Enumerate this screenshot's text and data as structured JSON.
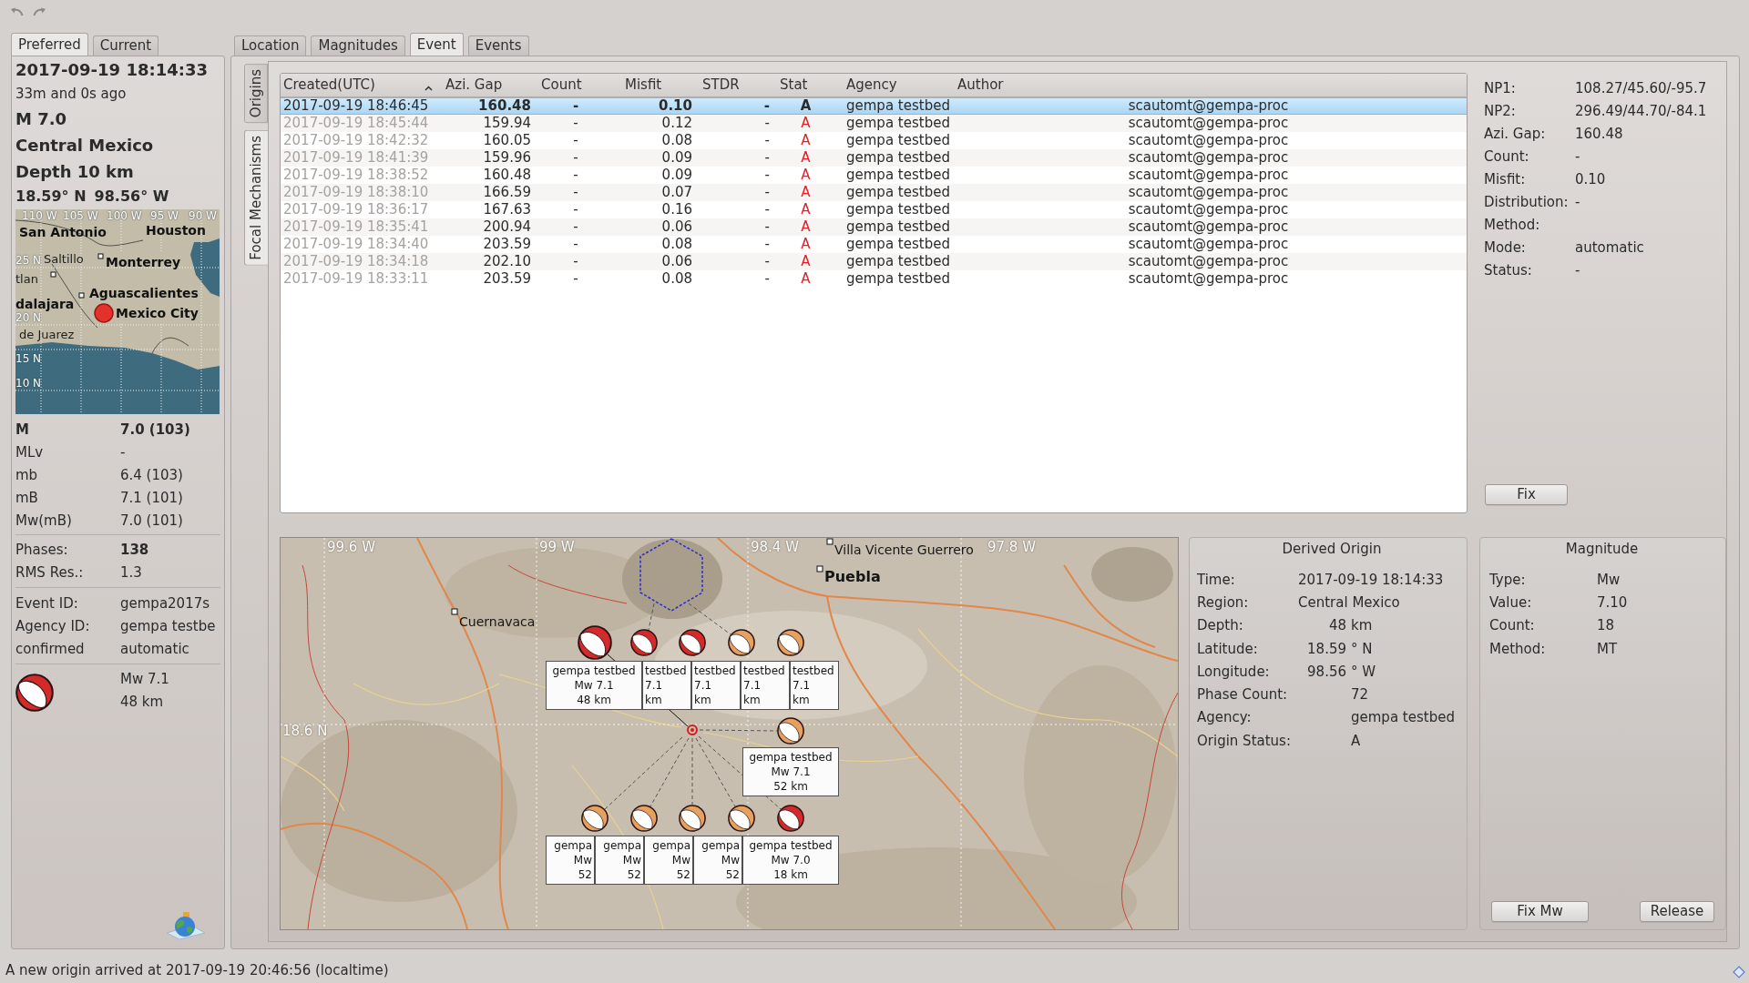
{
  "left_panel": {
    "tabs": [
      {
        "label": "Preferred",
        "selected": true
      },
      {
        "label": "Current",
        "selected": false
      }
    ],
    "summary": {
      "time": "2017-09-19 18:14:33",
      "age": "33m and 0s ago",
      "magnitude": "M 7.0",
      "region": "Central Mexico",
      "depth": "Depth 10 km",
      "latitude": "18.59° N",
      "longitude": "98.56° W"
    },
    "mini_map": {
      "grid_labels": [
        "110 W",
        "105 W",
        "100 W",
        "95 W",
        "90 W",
        "25 N",
        "20 N",
        "15 N",
        "10 N"
      ],
      "cities": [
        {
          "name": "San Antonio",
          "major": true
        },
        {
          "name": "Houston",
          "major": true
        },
        {
          "name": "Saltillo",
          "major": false
        },
        {
          "name": "tlan",
          "major": false
        },
        {
          "name": "Monterrey",
          "major": true
        },
        {
          "name": "Aguascalientes",
          "major": true
        },
        {
          "name": "dalajara",
          "major": true
        },
        {
          "name": "Mexico City",
          "major": true
        },
        {
          "name": "de Juarez",
          "major": false
        }
      ]
    },
    "magnitudes": [
      {
        "type": "M",
        "value": "7.0 (103)",
        "preferred": true
      },
      {
        "type": "MLv",
        "value": "-",
        "preferred": false
      },
      {
        "type": "mb",
        "value": "6.4 (103)",
        "preferred": false
      },
      {
        "type": "mB",
        "value": "7.1 (101)",
        "preferred": false
      },
      {
        "type": "Mw(mB)",
        "value": "7.0 (101)",
        "preferred": false
      }
    ],
    "quality": [
      {
        "label": "Phases:",
        "value": "138",
        "emphasized": true
      },
      {
        "label": "RMS Res.:",
        "value": "1.3",
        "emphasized": false
      }
    ],
    "identifiers": [
      {
        "label": "Event ID:",
        "value": "gempa2017s"
      },
      {
        "label": "Agency ID:",
        "value": "gempa testbe"
      },
      {
        "label": "confirmed",
        "value": "automatic"
      }
    ],
    "mechanism": {
      "magnitude": "Mw 7.1",
      "depth": "48 km"
    }
  },
  "main_tabs": [
    {
      "label": "Location",
      "selected": false
    },
    {
      "label": "Magnitudes",
      "selected": false
    },
    {
      "label": "Event",
      "selected": true
    },
    {
      "label": "Events",
      "selected": false
    }
  ],
  "side_tabs": [
    {
      "label": "Origins",
      "selected": false
    },
    {
      "label": "Focal Mechanisms",
      "selected": true
    }
  ],
  "table": {
    "columns": [
      {
        "label": "Created(UTC)",
        "sorted": true
      },
      {
        "label": "Azi. Gap",
        "sorted": false
      },
      {
        "label": "Count",
        "sorted": false
      },
      {
        "label": "Misfit",
        "sorted": false
      },
      {
        "label": "STDR",
        "sorted": false
      },
      {
        "label": "Stat",
        "sorted": false
      },
      {
        "label": "Agency",
        "sorted": false
      },
      {
        "label": "Author",
        "sorted": false
      }
    ],
    "rows": [
      {
        "cells": [
          "2017-09-19 18:46:45",
          "160.48",
          "-",
          "0.10",
          "-",
          "A",
          "gempa testbed",
          "scautomt@gempa-proc"
        ],
        "selected": true,
        "preferred": true
      },
      {
        "cells": [
          "2017-09-19 18:45:44",
          "159.94",
          "-",
          "0.12",
          "-",
          "A",
          "gempa testbed",
          "scautomt@gempa-proc"
        ],
        "selected": false,
        "preferred": false
      },
      {
        "cells": [
          "2017-09-19 18:42:32",
          "160.05",
          "-",
          "0.08",
          "-",
          "A",
          "gempa testbed",
          "scautomt@gempa-proc"
        ],
        "selected": false,
        "preferred": false
      },
      {
        "cells": [
          "2017-09-19 18:41:39",
          "159.96",
          "-",
          "0.09",
          "-",
          "A",
          "gempa testbed",
          "scautomt@gempa-proc"
        ],
        "selected": false,
        "preferred": false
      },
      {
        "cells": [
          "2017-09-19 18:38:52",
          "160.48",
          "-",
          "0.09",
          "-",
          "A",
          "gempa testbed",
          "scautomt@gempa-proc"
        ],
        "selected": false,
        "preferred": false
      },
      {
        "cells": [
          "2017-09-19 18:38:10",
          "166.59",
          "-",
          "0.07",
          "-",
          "A",
          "gempa testbed",
          "scautomt@gempa-proc"
        ],
        "selected": false,
        "preferred": false
      },
      {
        "cells": [
          "2017-09-19 18:36:17",
          "167.63",
          "-",
          "0.16",
          "-",
          "A",
          "gempa testbed",
          "scautomt@gempa-proc"
        ],
        "selected": false,
        "preferred": false
      },
      {
        "cells": [
          "2017-09-19 18:35:41",
          "200.94",
          "-",
          "0.06",
          "-",
          "A",
          "gempa testbed",
          "scautomt@gempa-proc"
        ],
        "selected": false,
        "preferred": false
      },
      {
        "cells": [
          "2017-09-19 18:34:40",
          "203.59",
          "-",
          "0.08",
          "-",
          "A",
          "gempa testbed",
          "scautomt@gempa-proc"
        ],
        "selected": false,
        "preferred": false
      },
      {
        "cells": [
          "2017-09-19 18:34:18",
          "202.10",
          "-",
          "0.06",
          "-",
          "A",
          "gempa testbed",
          "scautomt@gempa-proc"
        ],
        "selected": false,
        "preferred": false
      },
      {
        "cells": [
          "2017-09-19 18:33:11",
          "203.59",
          "-",
          "0.08",
          "-",
          "A",
          "gempa testbed",
          "scautomt@gempa-proc"
        ],
        "selected": false,
        "preferred": false
      }
    ]
  },
  "mechanism_details": {
    "rows": [
      {
        "label": "NP1:",
        "value": "108.27/45.60/-95.7"
      },
      {
        "label": "NP2:",
        "value": "296.49/44.70/-84.1"
      },
      {
        "label": "Azi. Gap:",
        "value": "160.48"
      },
      {
        "label": "Count:",
        "value": "-"
      },
      {
        "label": "Misfit:",
        "value": "0.10"
      },
      {
        "label": "Distribution:",
        "value": "-"
      },
      {
        "label": "Method:"
      },
      {
        "label": "Mode:",
        "value": "automatic"
      },
      {
        "label": "Status:",
        "value": "-"
      }
    ],
    "button": "Fix"
  },
  "map": {
    "grid_labels": [
      "99.6 W",
      "99 W",
      "98.4 W",
      "97.8 W",
      "18.6 N"
    ],
    "cities": [
      {
        "name": "Cuernavaca",
        "major": false
      },
      {
        "name": "Villa Vicente Guerrero",
        "major": false
      },
      {
        "name": "Puebla",
        "major": true
      }
    ],
    "mechanisms": [
      {
        "color": "#d42a2a",
        "label": [
          "gempa testbed",
          "Mw 7.1",
          "48 km"
        ]
      },
      {
        "color": "#d42a2a",
        "label": [
          "testbed",
          "7.1",
          "km"
        ]
      },
      {
        "color": "#d42a2a",
        "label": [
          "testbed",
          "7.1",
          "km"
        ]
      },
      {
        "color": "#e6a060",
        "label": [
          "testbed",
          "7.1",
          "km"
        ]
      },
      {
        "color": "#e6a060",
        "label": [
          "testbed",
          "7.1",
          "km"
        ]
      },
      {
        "color": "#e6a060",
        "label": [
          "gempa testbed",
          "Mw 7.1",
          "52 km"
        ]
      },
      {
        "color": "#e6a060",
        "label": [
          "gempa",
          "Mw",
          "52"
        ]
      },
      {
        "color": "#e6a060",
        "label": [
          "gempa",
          "Mw",
          "52"
        ]
      },
      {
        "color": "#e6a060",
        "label": [
          "gempa",
          "Mw",
          "52"
        ]
      },
      {
        "color": "#e6a060",
        "label": [
          "gempa",
          "Mw",
          "52"
        ]
      },
      {
        "color": "#d42a2a",
        "label": [
          "gempa testbed",
          "Mw 7.0",
          "18 km"
        ]
      }
    ]
  },
  "derived_origin": {
    "title": "Derived Origin",
    "rows": [
      {
        "kind": "wide",
        "label": "Time:",
        "value": "2017-09-19 18:14:33"
      },
      {
        "kind": "wide",
        "label": "Region:",
        "value": "Central Mexico"
      },
      {
        "kind": "measure",
        "label": "Depth:",
        "value": "48",
        "unit": "km"
      },
      {
        "kind": "measure",
        "label": "Latitude:",
        "value": "18.59",
        "unit": "° N"
      },
      {
        "kind": "measure",
        "label": "Longitude:",
        "value": "98.56",
        "unit": "° W"
      },
      {
        "kind": "plain",
        "label": "Phase Count:",
        "value": "72"
      },
      {
        "kind": "plain",
        "label": "Agency:",
        "value": "gempa testbed"
      },
      {
        "kind": "plain",
        "label": "Origin Status:",
        "value": "A"
      }
    ]
  },
  "magnitude": {
    "title": "Magnitude",
    "rows": [
      {
        "label": "Type:",
        "value": "Mw"
      },
      {
        "label": "Value:",
        "value": "7.10"
      },
      {
        "label": "Count:",
        "value": "18"
      },
      {
        "label": "Method:",
        "value": "MT"
      }
    ],
    "buttons": [
      "Fix Mw",
      "Release"
    ]
  },
  "status_bar": {
    "message": "A new origin arrived at 2017-09-19 20:46:56 (localtime)"
  }
}
